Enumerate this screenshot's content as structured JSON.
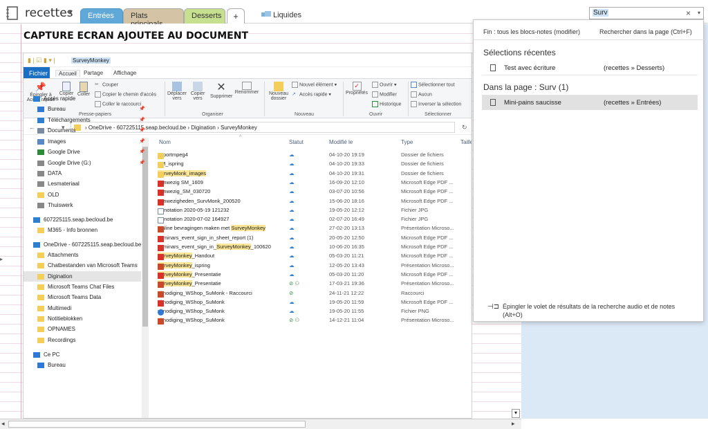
{
  "notebook": {
    "title": "recettes"
  },
  "sections": [
    {
      "label": "Entrées",
      "color": "#5fa8d8",
      "active": true
    },
    {
      "label": "Plats principals",
      "color": "#d4c4a5"
    },
    {
      "label": "Desserts",
      "color": "#c7e08f"
    }
  ],
  "add_tab": "+",
  "section_group": "Liquides",
  "search": {
    "value": "Surv",
    "close": "×",
    "dropdown": "▾"
  },
  "page": {
    "heading": "CAPTURE ECRAN AJOUTEE AU DOCUMENT"
  },
  "explorer": {
    "title": "SurveyMonkey",
    "ribbon_tabs": [
      "Fichier",
      "Accueil",
      "Partage",
      "Affichage"
    ],
    "ribbon": {
      "pin": "Épingler à Accès rapide",
      "copy": "Copier",
      "paste": "Coller",
      "cut": "Couper",
      "copy_path": "Copier le chemin d'accès",
      "paste_shortcut": "Coller le raccourci",
      "group_clipboard": "Presse-papiers",
      "move": "Déplacer vers",
      "copy_to": "Copier vers",
      "delete": "Supprimer",
      "rename": "Renommer",
      "group_organize": "Organiser",
      "new_folder": "Nouveau dossier",
      "new_item": "Nouvel élément",
      "easy_access": "Accès rapide",
      "group_new": "Nouveau",
      "properties": "Propriétés",
      "open": "Ouvrir",
      "edit": "Modifier",
      "history": "Historique",
      "group_open": "Ouvrir",
      "select_all": "Sélectionner tout",
      "select_none": "Aucun",
      "invert": "Inverser la sélection",
      "group_select": "Sélectionner"
    },
    "address": {
      "nav": "← → ▾ ↑",
      "path": "›  OneDrive - 607225115.seap.becloud.be  ›  Digination  ›  SurveyMonkey",
      "refresh": "↻"
    },
    "nav": [
      {
        "label": "Accès rapide",
        "icon": "star"
      },
      {
        "label": "Bureau",
        "icon": "desktop",
        "pin": true
      },
      {
        "label": "Téléchargements",
        "icon": "download",
        "pin": true
      },
      {
        "label": "Documents",
        "icon": "docs",
        "pin": true
      },
      {
        "label": "Images",
        "icon": "images",
        "pin": true
      },
      {
        "label": "Google Drive",
        "icon": "gdrive",
        "pin": true
      },
      {
        "label": "Google Drive (G:)",
        "icon": "drive",
        "pin": true
      },
      {
        "label": "DATA",
        "icon": "drive"
      },
      {
        "label": "Lesmateriaal",
        "icon": "drive"
      },
      {
        "label": "OLD",
        "icon": "folder"
      },
      {
        "label": "Thuiswerk",
        "icon": "drive"
      },
      {
        "label": "607225115.seap.becloud.be",
        "icon": "sharepoint"
      },
      {
        "label": "M365 - Info bronnen",
        "icon": "folder"
      },
      {
        "label": "OneDrive - 607225115.seap.becloud.be",
        "icon": "cloud"
      },
      {
        "label": "Attachments",
        "icon": "folder"
      },
      {
        "label": "Chatbestanden van Microsoft Teams",
        "icon": "folder"
      },
      {
        "label": "Digination",
        "icon": "folder",
        "selected": true
      },
      {
        "label": "Microsoft Teams Chat Files",
        "icon": "folder"
      },
      {
        "label": "Microsoft Teams Data",
        "icon": "folder"
      },
      {
        "label": "Multimedi",
        "icon": "folder"
      },
      {
        "label": "Notitieblokken",
        "icon": "folder"
      },
      {
        "label": "OPNAMES",
        "icon": "folder"
      },
      {
        "label": "Recordings",
        "icon": "folder"
      },
      {
        "label": "Ce PC",
        "icon": "pc"
      },
      {
        "label": "Bureau",
        "icon": "desktop"
      }
    ],
    "columns": [
      "Nom",
      "Statut",
      "Modifié le",
      "Type",
      "Taille"
    ],
    "files": [
      {
        "name": "exportmpeg4",
        "pre": "",
        "hl": "",
        "post": "",
        "type_icon": "folder",
        "status": "cloud",
        "date": "04-10-20 19:19",
        "type": "Dossier de fichiers"
      },
      {
        "name": "SM_ispring",
        "pre": "",
        "hl": "",
        "post": "",
        "type_icon": "folder",
        "status": "cloud",
        "date": "04-10-20 19:33",
        "type": "Dossier de fichiers"
      },
      {
        "name": "",
        "pre": "",
        "hl": "SurveyMonk_images",
        "post": "",
        "type_icon": "folder",
        "status": "cloud",
        "date": "04-10-20 19:31",
        "type": "Dossier de fichiers"
      },
      {
        "name": "aanwezig SM_1609",
        "pre": "",
        "hl": "",
        "post": "",
        "type_icon": "pdf",
        "status": "cloud",
        "date": "16-09-20 12:10",
        "type": "Microsoft Edge PDF ..."
      },
      {
        "name": "aanwezig_SM_030720",
        "pre": "",
        "hl": "",
        "post": "",
        "type_icon": "pdf",
        "status": "cloud",
        "date": "03-07-20 10:56",
        "type": "Microsoft Edge PDF ..."
      },
      {
        "name": "aanwezigheden_SurvMonk_200520",
        "pre": "",
        "hl": "",
        "post": "",
        "type_icon": "pdf",
        "status": "cloud",
        "date": "15-06-20 18:16",
        "type": "Microsoft Edge PDF ..."
      },
      {
        "name": "Annotation 2020-05-19 121232",
        "pre": "",
        "hl": "",
        "post": "",
        "type_icon": "jpg",
        "status": "cloud",
        "date": "19-05-20 12:12",
        "type": "Fichier JPG"
      },
      {
        "name": "Annotation 2020-07-02 164927",
        "pre": "",
        "hl": "",
        "post": "",
        "type_icon": "jpg",
        "status": "cloud",
        "date": "02-07-20 16:49",
        "type": "Fichier JPG"
      },
      {
        "name": "",
        "pre": "Online bevragingen maken met ",
        "hl": "SurveyMonkey",
        "post": "",
        "type_icon": "ppt",
        "status": "cloud",
        "date": "27-02-20 13:13",
        "type": "Présentation Microso..."
      },
      {
        "name": "seminars_event_sign_in_sheet_report (1)",
        "pre": "",
        "hl": "",
        "post": "",
        "type_icon": "pdf",
        "status": "cloud",
        "date": "20-05-20 12:50",
        "type": "Microsoft Edge PDF ..."
      },
      {
        "name": "",
        "pre": "seminars_event_sign_in_",
        "hl": "SurveyMonkey",
        "post": "_100620",
        "type_icon": "pdf",
        "status": "cloud",
        "date": "10-06-20 16:35",
        "type": "Microsoft Edge PDF ..."
      },
      {
        "name": "",
        "pre": "",
        "hl": "SurveyMonkey",
        "post": "_Handout",
        "type_icon": "pdf",
        "status": "cloud",
        "date": "05-03-20 11:21",
        "type": "Microsoft Edge PDF ..."
      },
      {
        "name": "",
        "pre": "",
        "hl": "SurveyMonkey",
        "post": "_ispring",
        "type_icon": "ppt",
        "status": "cloud",
        "date": "12-05-20 13:43",
        "type": "Présentation Microso..."
      },
      {
        "name": "",
        "pre": "",
        "hl": "SurveyMonkey",
        "post": "_Presentatie",
        "type_icon": "pdf",
        "status": "cloud",
        "date": "05-03-20 11:20",
        "type": "Microsoft Edge PDF ..."
      },
      {
        "name": "",
        "pre": "",
        "hl": "SurveyMonkey",
        "post": "_Presentatie",
        "type_icon": "ppt",
        "status": "ok-shared",
        "date": "17-03-21 19:36",
        "type": "Présentation Microso..."
      },
      {
        "name": "uitnodiging_WShop_SuMonk - Raccourci",
        "pre": "",
        "hl": "",
        "post": "",
        "type_icon": "lnk",
        "status": "ok",
        "date": "24-11-21 12:22",
        "type": "Raccourci"
      },
      {
        "name": "uitnodiging_WShop_SuMonk",
        "pre": "",
        "hl": "",
        "post": "",
        "type_icon": "pdf",
        "status": "cloud",
        "date": "19-05-20 11:59",
        "type": "Microsoft Edge PDF ..."
      },
      {
        "name": "uitnodiging_WShop_SuMonk",
        "pre": "",
        "hl": "",
        "post": "",
        "type_icon": "png",
        "status": "cloud",
        "date": "19-05-20 11:55",
        "type": "Fichier PNG"
      },
      {
        "name": "uitnodiging_WShop_SuMonk",
        "pre": "",
        "hl": "",
        "post": "",
        "type_icon": "ppt",
        "status": "ok-shared",
        "date": "14-12-21 11:04",
        "type": "Présentation Microso..."
      }
    ]
  },
  "search_panel": {
    "scope": "Fin : tous les blocs-notes (modifier)",
    "page_search": "Rechercher dans la page (Ctrl+F)",
    "recent_heading": "Sélections récentes",
    "recent": [
      {
        "title": "Test avec écriture",
        "location": "(recettes » Desserts)"
      }
    ],
    "page_heading": "Dans la page : Surv (1)",
    "results": [
      {
        "title": "Mini-pains saucisse",
        "location": "(recettes » Entrées)"
      }
    ],
    "pin_text": "Épingler le volet de résultats de la recherche audio et de notes (Alt+O)"
  }
}
